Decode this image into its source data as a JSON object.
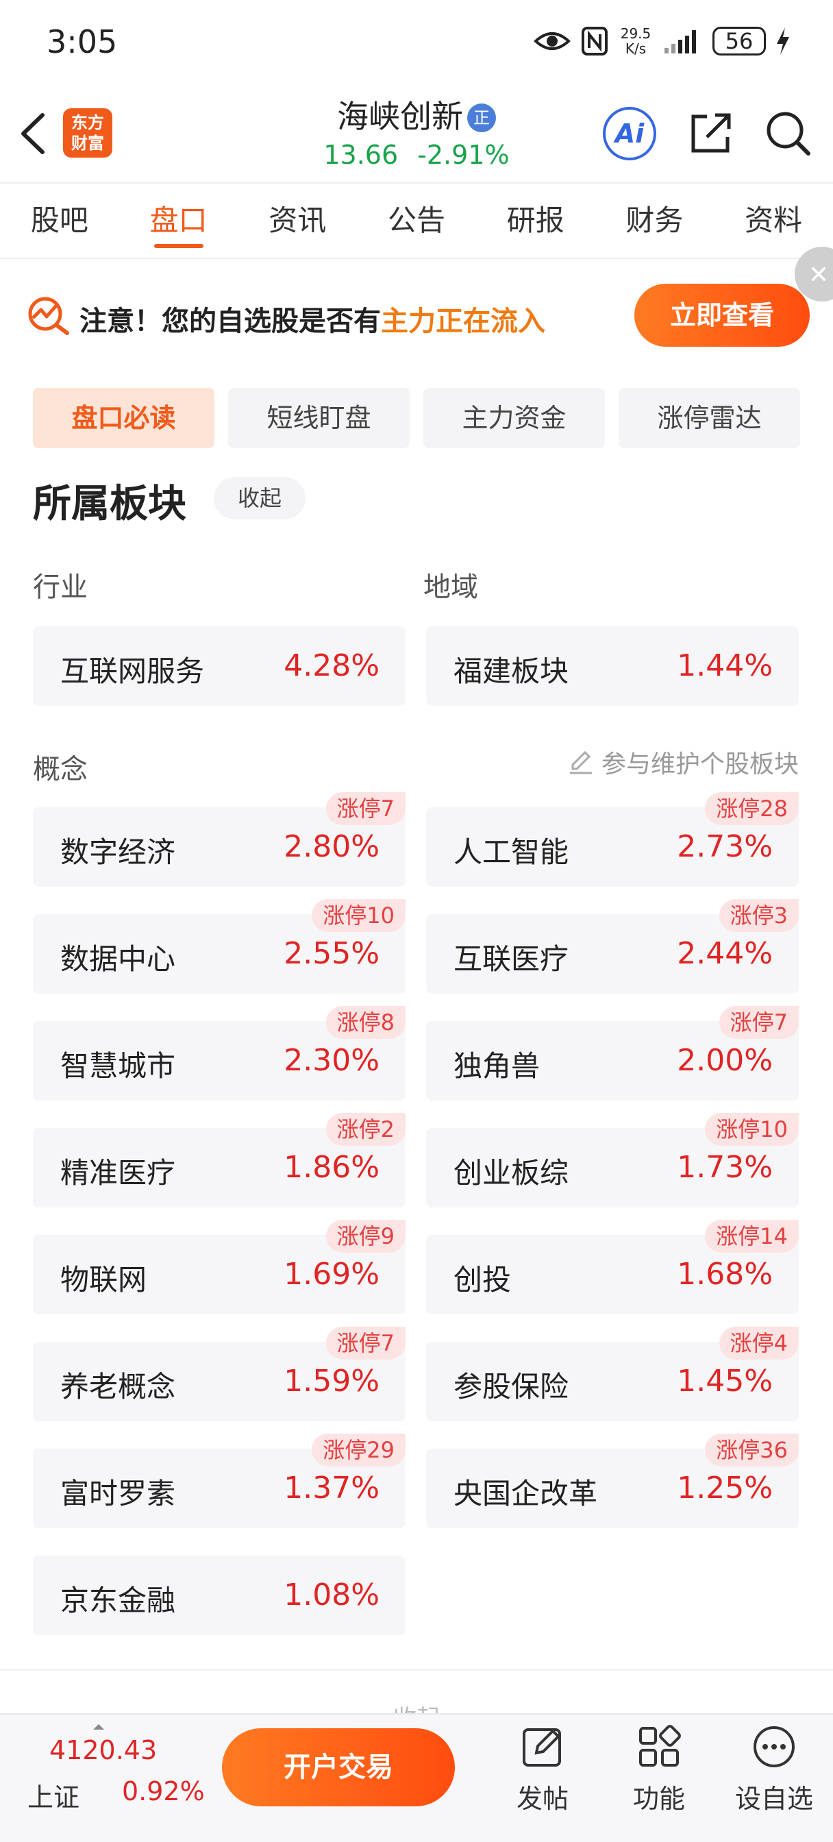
{
  "status_bar": {
    "time": "3:05",
    "net_speed_value": "29.5",
    "net_speed_unit": "K/s",
    "battery": "56",
    "icons": [
      "eye-icon",
      "nfc-icon",
      "signal-icon",
      "battery-icon",
      "charging-icon"
    ]
  },
  "header": {
    "logo_line1": "东方",
    "logo_line2": "财富",
    "stock_name": "海峡创新",
    "badge": "正",
    "price": "13.66",
    "change_pct": "-2.91%",
    "ai_label": "Ai",
    "price_color": "#17a34a"
  },
  "tabs": [
    {
      "label": "股吧",
      "active": false
    },
    {
      "label": "盘口",
      "active": true
    },
    {
      "label": "资讯",
      "active": false
    },
    {
      "label": "公告",
      "active": false
    },
    {
      "label": "研报",
      "active": false
    },
    {
      "label": "财务",
      "active": false
    },
    {
      "label": "资料",
      "active": false
    }
  ],
  "banner": {
    "text_prefix": "注意！您的自选股是否有",
    "text_highlight": "主力正在流入",
    "button": "立即查看",
    "close": "✕"
  },
  "subtabs": [
    {
      "label": "盘口必读",
      "active": true
    },
    {
      "label": "短线盯盘",
      "active": false
    },
    {
      "label": "主力资金",
      "active": false
    },
    {
      "label": "涨停雷达",
      "active": false
    }
  ],
  "section": {
    "title": "所属板块",
    "collapse": "收起",
    "industry_label": "行业",
    "region_label": "地域",
    "concept_label": "概念",
    "maintain_link": "参与维护个股板块"
  },
  "industry": {
    "name": "互联网服务",
    "pct": "4.28%"
  },
  "region": {
    "name": "福建板块",
    "pct": "1.44%"
  },
  "concepts": [
    {
      "name": "数字经济",
      "pct": "2.80%",
      "limit": "涨停7"
    },
    {
      "name": "人工智能",
      "pct": "2.73%",
      "limit": "涨停28"
    },
    {
      "name": "数据中心",
      "pct": "2.55%",
      "limit": "涨停10"
    },
    {
      "name": "互联医疗",
      "pct": "2.44%",
      "limit": "涨停3"
    },
    {
      "name": "智慧城市",
      "pct": "2.30%",
      "limit": "涨停8"
    },
    {
      "name": "独角兽",
      "pct": "2.00%",
      "limit": "涨停7"
    },
    {
      "name": "精准医疗",
      "pct": "1.86%",
      "limit": "涨停2"
    },
    {
      "name": "创业板综",
      "pct": "1.73%",
      "limit": "涨停10"
    },
    {
      "name": "物联网",
      "pct": "1.69%",
      "limit": "涨停9"
    },
    {
      "name": "创投",
      "pct": "1.68%",
      "limit": "涨停14"
    },
    {
      "name": "养老概念",
      "pct": "1.59%",
      "limit": "涨停7"
    },
    {
      "name": "参股保险",
      "pct": "1.45%",
      "limit": "涨停4"
    },
    {
      "name": "富时罗素",
      "pct": "1.37%",
      "limit": "涨停29"
    },
    {
      "name": "央国企改革",
      "pct": "1.25%",
      "limit": "涨停36"
    },
    {
      "name": "京东金融",
      "pct": "1.08%",
      "limit": ""
    }
  ],
  "collapse_bottom": "收起",
  "bottom_bar": {
    "index_value": "4120.43",
    "index_name": "上证",
    "index_change": "0.92%",
    "trade_button": "开户交易",
    "post": "发帖",
    "functions": "功能",
    "add_watch": "设自选"
  },
  "colors": {
    "accent": "#f05a1a",
    "up": "#e02424",
    "down": "#17a34a"
  }
}
